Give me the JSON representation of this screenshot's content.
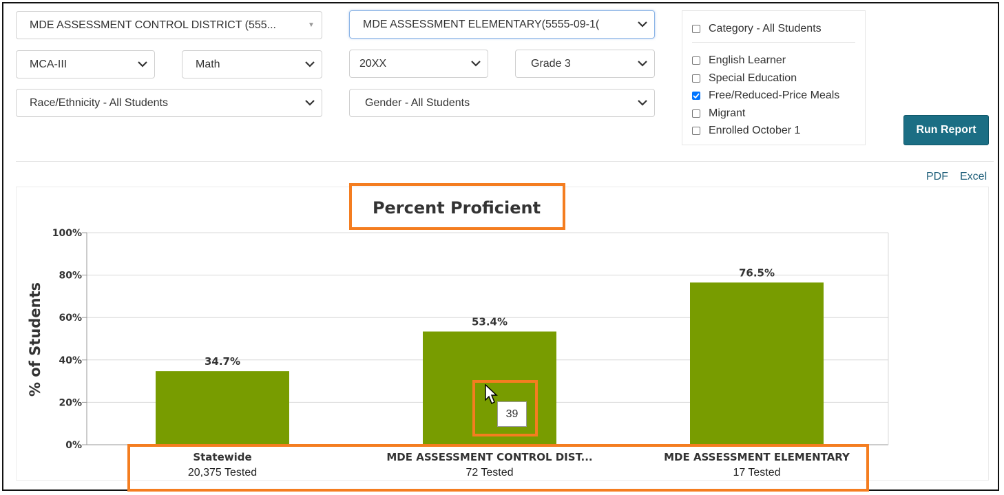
{
  "selectors": {
    "district": "MDE ASSESSMENT CONTROL DISTRICT (555...",
    "school": "MDE ASSESSMENT ELEMENTARY(5555-09-1(",
    "test": "MCA-III",
    "subject": "Math",
    "year": "20XX",
    "grade": "Grade 3",
    "race": "Race/Ethnicity - All Students",
    "gender": "Gender - All Students"
  },
  "filters": {
    "category": {
      "label": "Category - All Students",
      "checked": false
    },
    "items": [
      {
        "label": "English Learner",
        "checked": false
      },
      {
        "label": "Special Education",
        "checked": false
      },
      {
        "label": "Free/Reduced-Price Meals",
        "checked": true
      },
      {
        "label": "Migrant",
        "checked": false
      },
      {
        "label": "Enrolled October 1",
        "checked": false
      }
    ]
  },
  "run_button": "Run Report",
  "exports": {
    "pdf": "PDF",
    "excel": "Excel"
  },
  "tooltip": "39",
  "colors": {
    "bar": "#789c00",
    "highlight": "#f47d20",
    "button": "#1b6e84"
  },
  "chart_data": {
    "type": "bar",
    "title": "Percent Proficient",
    "ylabel": "% of Students",
    "ylim": [
      0,
      100
    ],
    "yticks": [
      "0%",
      "20%",
      "40%",
      "60%",
      "80%",
      "100%"
    ],
    "categories": [
      "Statewide",
      "MDE ASSESSMENT CONTROL DIST...",
      "MDE ASSESSMENT ELEMENTARY"
    ],
    "sublabels": [
      "20,375 Tested",
      "72 Tested",
      "17 Tested"
    ],
    "values": [
      34.7,
      53.4,
      76.5
    ],
    "data_labels": [
      "34.7%",
      "53.4%",
      "76.5%"
    ],
    "grid": true
  }
}
